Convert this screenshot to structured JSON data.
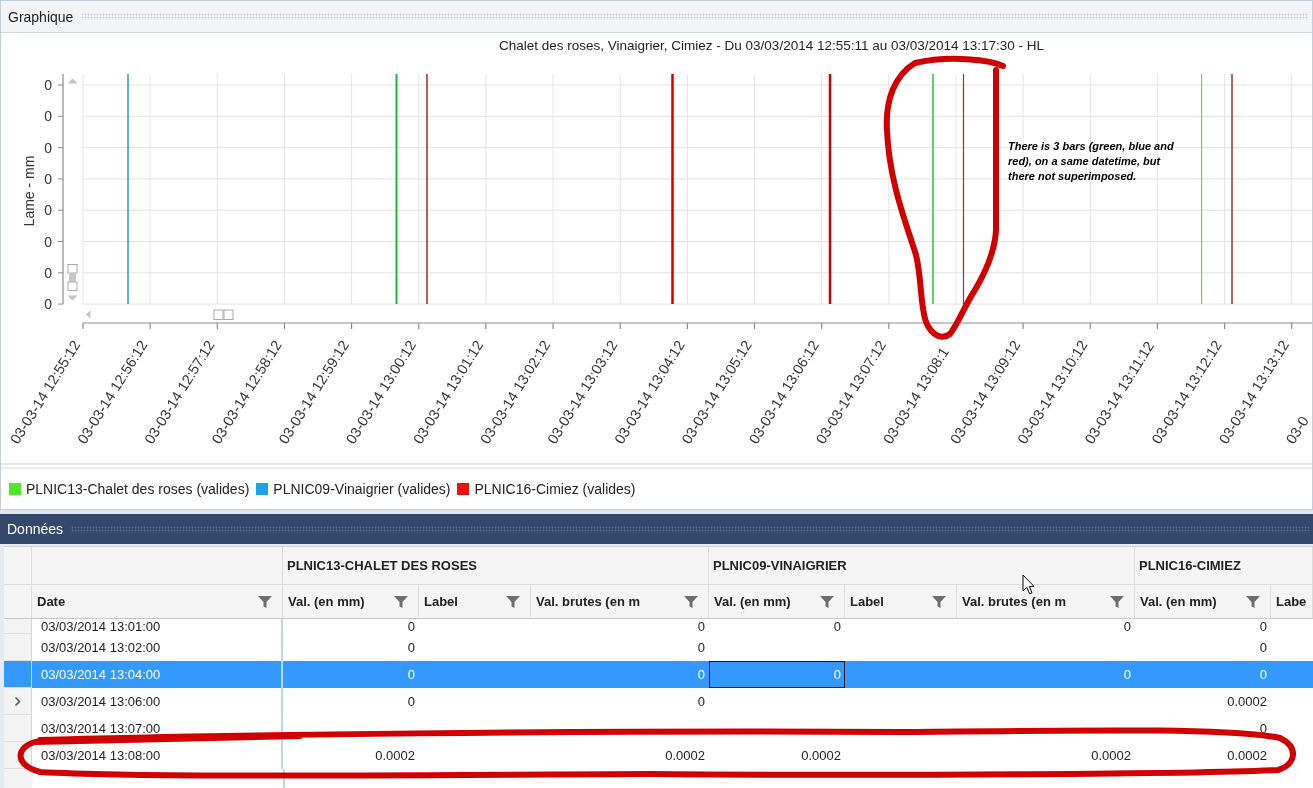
{
  "graph_panel": {
    "title": "Graphique"
  },
  "chart": {
    "title": "Chalet des roses, Vinaigrier, Cimiez - Du 03/03/2014 12:55:11 au 03/03/2014 13:17:30 - HL",
    "y_axis_label": "Lame - mm",
    "y_tick_labels": [
      "0",
      "0",
      "0",
      "0",
      "0",
      "0",
      "0",
      "0"
    ],
    "x_tick_labels": [
      "03-03-14 12:55:12",
      "03-03-14 12:56:12",
      "03-03-14 12:57:12",
      "03-03-14 12:58:12",
      "03-03-14 12:59:12",
      "03-03-14 13:00:12",
      "03-03-14 13:01:12",
      "03-03-14 13:02:12",
      "03-03-14 13:03:12",
      "03-03-14 13:04:12",
      "03-03-14 13:05:12",
      "03-03-14 13:06:12",
      "03-03-14 13:07:12",
      "03-03-14 13:08:1",
      "03-03-14 13:09:12",
      "03-03-14 13:10:12",
      "03-03-14 13:11:12",
      "03-03-14 13:12:12",
      "03-03-14 13:13:12",
      "03-0"
    ],
    "legend": [
      {
        "label": "PLNIC13-Chalet des roses (valides)",
        "color": "#4de82a"
      },
      {
        "label": "PLNIC09-Vinaigrier (valides)",
        "color": "#1aa3e8"
      },
      {
        "label": "PLNIC16-Cimiez (valides)",
        "color": "#ee1111"
      }
    ]
  },
  "annotation": {
    "note": "There is 3 bars (green, blue and red), on a same datetime, but there not superimposed."
  },
  "data_panel": {
    "title": "Données"
  },
  "grid": {
    "date_column": {
      "label": "Date",
      "filter": true
    },
    "groups": [
      {
        "label": "PLNIC13-CHALET DES ROSES",
        "columns": [
          {
            "label": "Val. (en mm)",
            "filter": true
          },
          {
            "label": "Label",
            "filter": true
          },
          {
            "label": "Val. brutes (en m",
            "filter": true
          }
        ]
      },
      {
        "label": "PLNIC09-VINAIGRIER",
        "columns": [
          {
            "label": "Val. (en mm)",
            "filter": true
          },
          {
            "label": "Label",
            "filter": true
          },
          {
            "label": "Val. brutes (en m",
            "filter": true
          }
        ]
      },
      {
        "label": "PLNIC16-CIMIEZ",
        "columns": [
          {
            "label": "Val. (en mm)",
            "filter": true
          },
          {
            "label": "Labe",
            "filter": false
          }
        ]
      }
    ],
    "rows": [
      {
        "date": "03/03/2014 13:01:00",
        "selected": false,
        "current": false,
        "cells": [
          {
            "value": "0",
            "focused": false
          },
          {
            "focused": false
          },
          {
            "value": "0",
            "focused": false
          },
          {
            "value": "0",
            "focused": false
          },
          {
            "focused": false
          },
          {
            "value": "0",
            "focused": false
          },
          {
            "value": "0",
            "focused": false
          },
          {
            "focused": false
          }
        ]
      },
      {
        "date": "03/03/2014 13:02:00",
        "selected": false,
        "current": false,
        "cells": [
          {
            "value": "0",
            "focused": false
          },
          {
            "focused": false
          },
          {
            "value": "0",
            "focused": false
          },
          {
            "focused": false
          },
          {
            "focused": false
          },
          {
            "focused": false
          },
          {
            "value": "0",
            "focused": false
          },
          {
            "focused": false
          }
        ]
      },
      {
        "date": "03/03/2014 13:04:00",
        "selected": true,
        "current": false,
        "cells": [
          {
            "value": "0",
            "focused": false
          },
          {
            "focused": false
          },
          {
            "value": "0",
            "focused": false
          },
          {
            "value": "0",
            "focused": true
          },
          {
            "focused": false
          },
          {
            "value": "0",
            "focused": false
          },
          {
            "value": "0",
            "focused": false
          },
          {
            "focused": false
          }
        ]
      },
      {
        "date": "03/03/2014 13:06:00",
        "selected": false,
        "current": true,
        "cells": [
          {
            "value": "0",
            "focused": false
          },
          {
            "focused": false
          },
          {
            "value": "0",
            "focused": false
          },
          {
            "focused": false
          },
          {
            "focused": false
          },
          {
            "focused": false
          },
          {
            "value": "0.0002",
            "focused": false
          },
          {
            "focused": false
          }
        ]
      },
      {
        "date": "03/03/2014 13:07:00",
        "selected": false,
        "current": false,
        "cells": [
          {
            "focused": false
          },
          {
            "focused": false
          },
          {
            "focused": false
          },
          {
            "focused": false
          },
          {
            "focused": false
          },
          {
            "focused": false
          },
          {
            "value": "0",
            "focused": false
          },
          {
            "focused": false
          }
        ]
      },
      {
        "date": "03/03/2014 13:08:00",
        "selected": false,
        "current": false,
        "cells": [
          {
            "value": "0.0002",
            "focused": false
          },
          {
            "focused": false
          },
          {
            "value": "0.0002",
            "focused": false
          },
          {
            "value": "0.0002",
            "focused": false
          },
          {
            "focused": false
          },
          {
            "value": "0.0002",
            "focused": false
          },
          {
            "value": "0.0002",
            "focused": false
          },
          {
            "focused": false
          }
        ]
      }
    ]
  }
}
